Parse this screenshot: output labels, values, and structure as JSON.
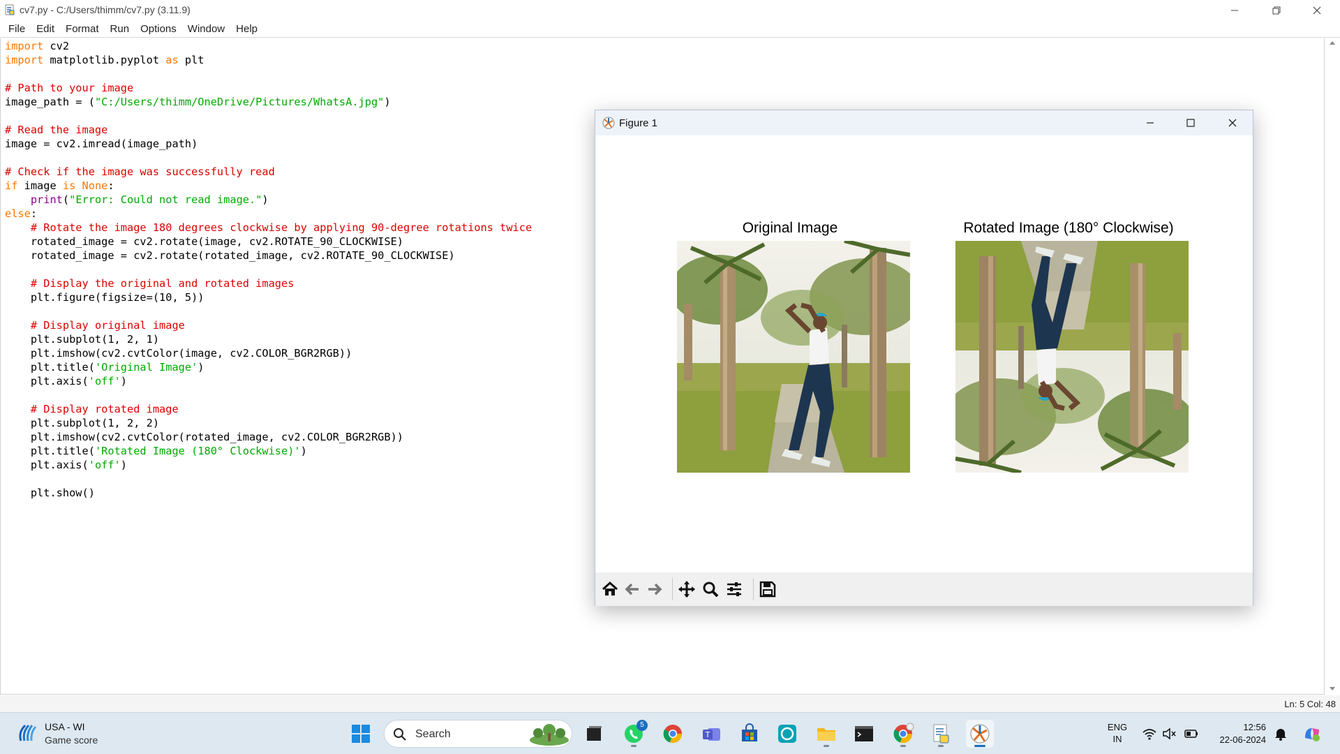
{
  "window": {
    "title": "cv7.py - C:/Users/thimm/cv7.py (3.11.9)",
    "controls": {
      "minimize": "minimize-icon",
      "maximize": "restore-icon",
      "close": "close-icon"
    }
  },
  "menu": [
    "File",
    "Edit",
    "Format",
    "Run",
    "Options",
    "Window",
    "Help"
  ],
  "code_lines": [
    [
      {
        "t": "import",
        "c": "kw"
      },
      {
        "t": " cv2",
        "c": ""
      }
    ],
    [
      {
        "t": "import",
        "c": "kw"
      },
      {
        "t": " matplotlib.pyplot ",
        "c": ""
      },
      {
        "t": "as",
        "c": "kw"
      },
      {
        "t": " plt",
        "c": ""
      }
    ],
    [],
    [
      {
        "t": "# Path to your image",
        "c": "cm"
      }
    ],
    [
      {
        "t": "image_path = (",
        "c": ""
      },
      {
        "t": "\"C:/Users/thimm/OneDrive/Pictures/WhatsA.jpg\"",
        "c": "st"
      },
      {
        "t": ")",
        "c": ""
      }
    ],
    [],
    [
      {
        "t": "# Read the image",
        "c": "cm"
      }
    ],
    [
      {
        "t": "image = cv2.imread(image_path)",
        "c": ""
      }
    ],
    [],
    [
      {
        "t": "# Check if the image was successfully read",
        "c": "cm"
      }
    ],
    [
      {
        "t": "if",
        "c": "kw"
      },
      {
        "t": " image ",
        "c": ""
      },
      {
        "t": "is",
        "c": "kw"
      },
      {
        "t": " ",
        "c": ""
      },
      {
        "t": "None",
        "c": "kw"
      },
      {
        "t": ":",
        "c": ""
      }
    ],
    [
      {
        "t": "    ",
        "c": ""
      },
      {
        "t": "print",
        "c": "bi"
      },
      {
        "t": "(",
        "c": ""
      },
      {
        "t": "\"Error: Could not read image.\"",
        "c": "st"
      },
      {
        "t": ")",
        "c": ""
      }
    ],
    [
      {
        "t": "else",
        "c": "kw"
      },
      {
        "t": ":",
        "c": ""
      }
    ],
    [
      {
        "t": "    ",
        "c": ""
      },
      {
        "t": "# Rotate the image 180 degrees clockwise by applying 90-degree rotations twice",
        "c": "cm"
      }
    ],
    [
      {
        "t": "    rotated_image = cv2.rotate(image, cv2.ROTATE_90_CLOCKWISE)",
        "c": ""
      }
    ],
    [
      {
        "t": "    rotated_image = cv2.rotate(rotated_image, cv2.ROTATE_90_CLOCKWISE)",
        "c": ""
      }
    ],
    [],
    [
      {
        "t": "    ",
        "c": ""
      },
      {
        "t": "# Display the original and rotated images",
        "c": "cm"
      }
    ],
    [
      {
        "t": "    plt.figure(figsize=(10, 5))",
        "c": ""
      }
    ],
    [],
    [
      {
        "t": "    ",
        "c": ""
      },
      {
        "t": "# Display original image",
        "c": "cm"
      }
    ],
    [
      {
        "t": "    plt.subplot(1, 2, 1)",
        "c": ""
      }
    ],
    [
      {
        "t": "    plt.imshow(cv2.cvtColor(image, cv2.COLOR_BGR2RGB))",
        "c": ""
      }
    ],
    [
      {
        "t": "    plt.title(",
        "c": ""
      },
      {
        "t": "'Original Image'",
        "c": "st"
      },
      {
        "t": ")",
        "c": ""
      }
    ],
    [
      {
        "t": "    plt.axis(",
        "c": ""
      },
      {
        "t": "'off'",
        "c": "st"
      },
      {
        "t": ")",
        "c": ""
      }
    ],
    [],
    [
      {
        "t": "    ",
        "c": ""
      },
      {
        "t": "# Display rotated image",
        "c": "cm"
      }
    ],
    [
      {
        "t": "    plt.subplot(1, 2, 2)",
        "c": ""
      }
    ],
    [
      {
        "t": "    plt.imshow(cv2.cvtColor(rotated_image, cv2.COLOR_BGR2RGB))",
        "c": ""
      }
    ],
    [
      {
        "t": "    plt.title(",
        "c": ""
      },
      {
        "t": "'Rotated Image (180° Clockwise)'",
        "c": "st"
      },
      {
        "t": ")",
        "c": ""
      }
    ],
    [
      {
        "t": "    plt.axis(",
        "c": ""
      },
      {
        "t": "'off'",
        "c": "st"
      },
      {
        "t": ")",
        "c": ""
      }
    ],
    [],
    [
      {
        "t": "    plt.show()",
        "c": ""
      }
    ]
  ],
  "colors": {
    "keyword": "#ff7700",
    "comment": "#dd0000",
    "string": "#00aa00",
    "builtin": "#900090",
    "taskbar": "#dde8f1"
  },
  "status": {
    "position": "Ln: 5  Col: 48"
  },
  "figure": {
    "title": "Figure 1",
    "subplot1_title": "Original Image",
    "subplot2_title": "Rotated Image (180° Clockwise)",
    "toolbar": [
      "home-icon",
      "back-icon",
      "forward-icon",
      "pan-icon",
      "zoom-icon",
      "configure-subplots-icon",
      "save-icon"
    ]
  },
  "taskbar": {
    "weather": {
      "line1": "USA - WI",
      "line2": "Game score"
    },
    "search_placeholder": "Search",
    "whatsapp_badge": "5",
    "apps": [
      "windows-start-icon",
      "search-icon",
      "task-view-icon",
      "whatsapp-icon",
      "chrome-icon",
      "teams-icon",
      "store-icon",
      "alexa-icon",
      "file-explorer-icon",
      "terminal-icon",
      "chrome-profile-icon",
      "python-idle-icon",
      "matplotlib-figure-icon"
    ],
    "lang": {
      "line1": "ENG",
      "line2": "IN"
    },
    "clock": {
      "time": "12:56",
      "date": "22-06-2024"
    }
  }
}
